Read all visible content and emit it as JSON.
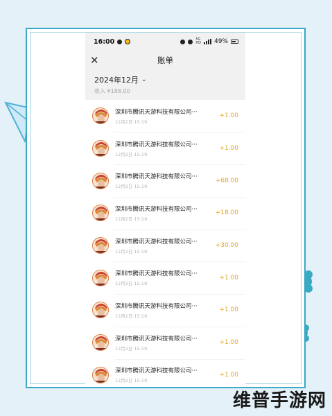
{
  "status": {
    "time": "16:00",
    "network_label": "5G\nHD",
    "battery": "49%"
  },
  "nav": {
    "title": "账单"
  },
  "month": {
    "label": "2024年12月",
    "summary": "收入 ¥188.00"
  },
  "transactions": [
    {
      "merchant": "深圳市腾讯天游科技有限公司···",
      "date": "12月2日 15:19",
      "amount": "+1.00"
    },
    {
      "merchant": "深圳市腾讯天游科技有限公司···",
      "date": "12月2日 15:19",
      "amount": "+1.00"
    },
    {
      "merchant": "深圳市腾讯天游科技有限公司···",
      "date": "12月2日 15:19",
      "amount": "+68.00"
    },
    {
      "merchant": "深圳市腾讯天游科技有限公司···",
      "date": "12月2日 15:19",
      "amount": "+18.00"
    },
    {
      "merchant": "深圳市腾讯天游科技有限公司···",
      "date": "12月2日 15:19",
      "amount": "+30.00"
    },
    {
      "merchant": "深圳市腾讯天游科技有限公司···",
      "date": "12月2日 15:19",
      "amount": "+1.00"
    },
    {
      "merchant": "深圳市腾讯天游科技有限公司···",
      "date": "12月2日 15:19",
      "amount": "+1.00"
    },
    {
      "merchant": "深圳市腾讯天游科技有限公司···",
      "date": "12月2日 15:19",
      "amount": "+1.00"
    },
    {
      "merchant": "深圳市腾讯天游科技有限公司···",
      "date": "12月2日 15:19",
      "amount": "+1.00"
    }
  ],
  "watermark": "维普手游网",
  "icons": {
    "close": "close-icon",
    "chevron": "chevron-down-icon",
    "avatar": "game-hero-avatar"
  },
  "colors": {
    "amount": "#e8a31b",
    "frame": "#3aa9c2",
    "background": "#e4f1f9"
  }
}
